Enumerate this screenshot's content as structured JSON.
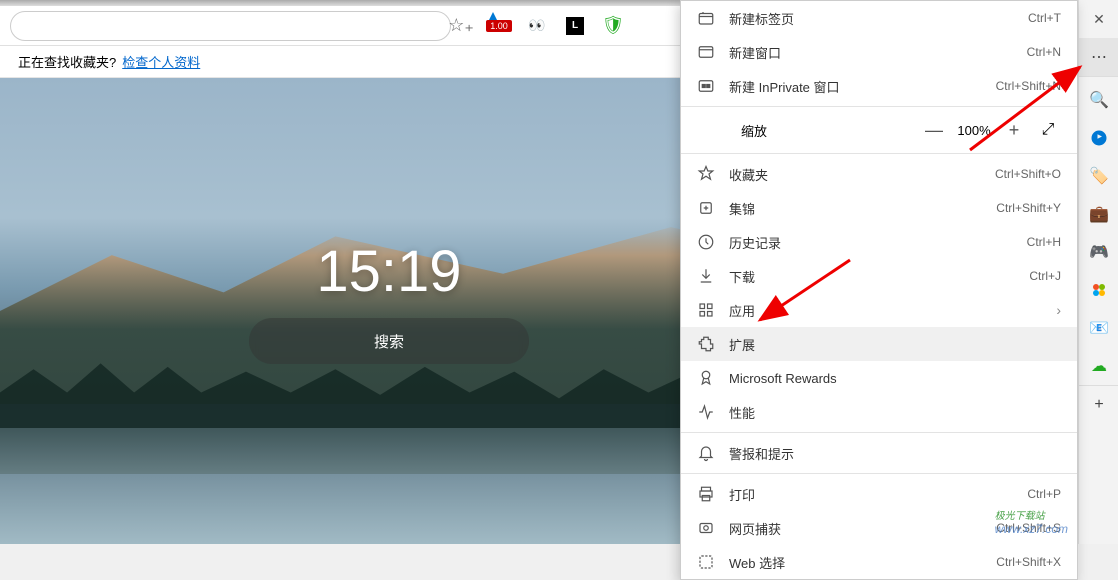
{
  "address": {
    "placeholder": ""
  },
  "toolbar": {
    "badge": "1.00",
    "ext_letter": "L"
  },
  "favtip": {
    "text": "正在查找收藏夹?",
    "link": "检查个人资料"
  },
  "newtab": {
    "time": "15:19",
    "search_placeholder": "搜索"
  },
  "menu": {
    "new_tab": "新建标签页",
    "new_tab_sc": "Ctrl+T",
    "new_window": "新建窗口",
    "new_window_sc": "Ctrl+N",
    "new_inprivate": "新建 InPrivate 窗口",
    "new_inprivate_sc": "Ctrl+Shift+N",
    "zoom_label": "缩放",
    "zoom_minus": "—",
    "zoom_value": "100%",
    "zoom_plus": "+",
    "zoom_full": "⤢",
    "favorites": "收藏夹",
    "favorites_sc": "Ctrl+Shift+O",
    "collections": "集锦",
    "collections_sc": "Ctrl+Shift+Y",
    "history": "历史记录",
    "history_sc": "Ctrl+H",
    "downloads": "下载",
    "downloads_sc": "Ctrl+J",
    "apps": "应用",
    "extensions": "扩展",
    "rewards": "Microsoft Rewards",
    "performance": "性能",
    "alerts": "警报和提示",
    "print": "打印",
    "print_sc": "Ctrl+P",
    "webcapture": "网页捕获",
    "webcapture_sc": "Ctrl+Shift+S",
    "webselect": "Web 选择",
    "webselect_sc": "Ctrl+Shift+X"
  },
  "watermark": {
    "line1": "极光下载站",
    "line2": "www.xz7.com"
  }
}
